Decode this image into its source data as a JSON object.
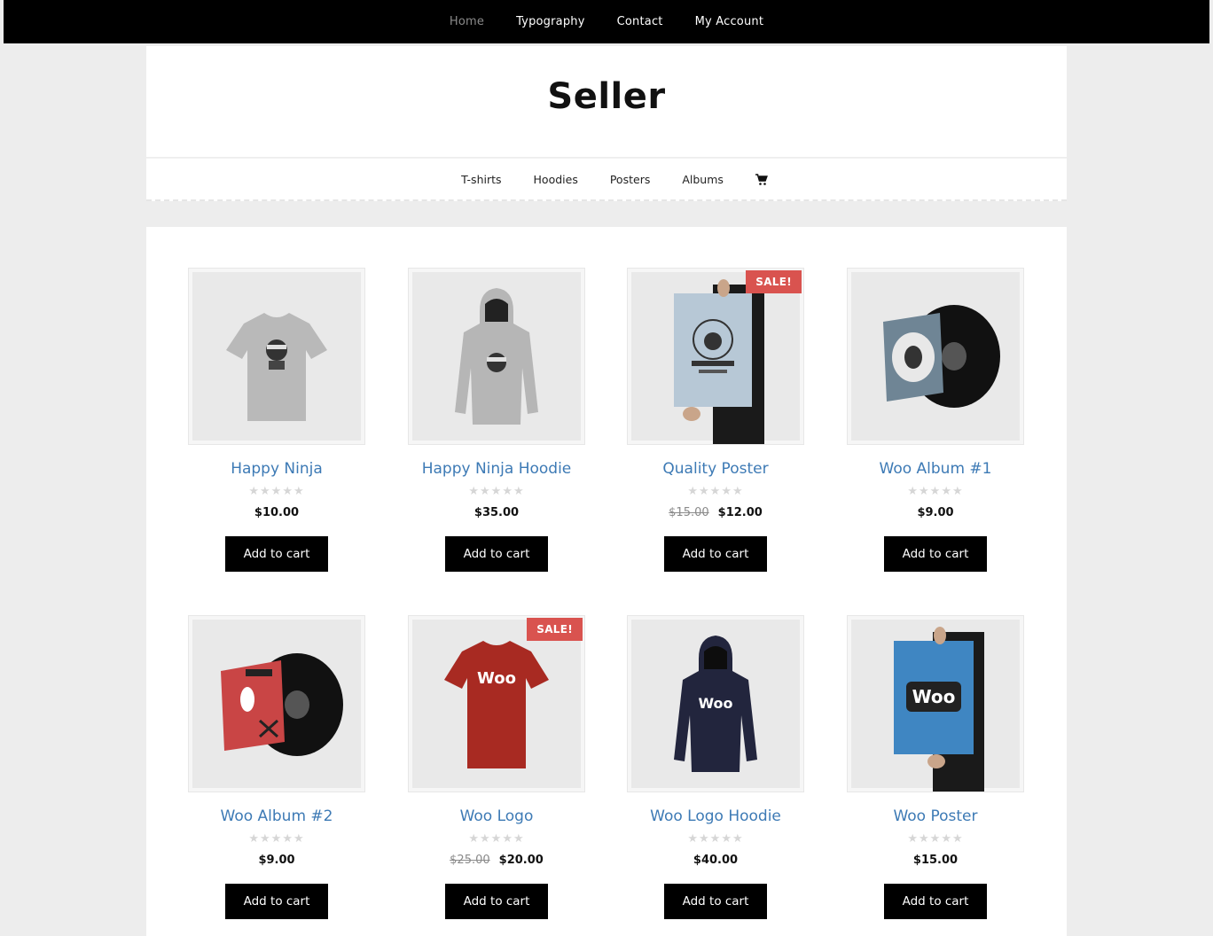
{
  "topnav": {
    "items": [
      {
        "label": "Home",
        "active": true
      },
      {
        "label": "Typography"
      },
      {
        "label": "Contact"
      },
      {
        "label": "My Account"
      }
    ]
  },
  "site": {
    "title": "Seller"
  },
  "categories": {
    "items": [
      "T-shirts",
      "Hoodies",
      "Posters",
      "Albums"
    ],
    "cart_icon": "cart-icon"
  },
  "products": [
    {
      "name": "Happy Ninja",
      "price": "$10.00",
      "old_price": "",
      "sale": "",
      "rating_stars": "★★★★★",
      "button": "Add to cart",
      "image": "grey-ninja-tshirt"
    },
    {
      "name": "Happy Ninja Hoodie",
      "price": "$35.00",
      "old_price": "",
      "sale": "",
      "rating_stars": "★★★★★",
      "button": "Add to cart",
      "image": "grey-ninja-hoodie"
    },
    {
      "name": "Quality Poster",
      "price": "$12.00",
      "old_price": "$15.00",
      "sale": "SALE!",
      "rating_stars": "★★★★★",
      "button": "Add to cart",
      "image": "blue-woothemes-poster"
    },
    {
      "name": "Woo Album #1",
      "price": "$9.00",
      "old_price": "",
      "sale": "",
      "rating_stars": "★★★★★",
      "button": "Add to cart",
      "image": "blue-album-vinyl"
    },
    {
      "name": "Woo Album #2",
      "price": "$9.00",
      "old_price": "",
      "sale": "",
      "rating_stars": "★★★★★",
      "button": "Add to cart",
      "image": "red-album-vinyl"
    },
    {
      "name": "Woo Logo",
      "price": "$20.00",
      "old_price": "$25.00",
      "sale": "SALE!",
      "rating_stars": "★★★★★",
      "button": "Add to cart",
      "image": "red-woo-tshirt"
    },
    {
      "name": "Woo Logo Hoodie",
      "price": "$40.00",
      "old_price": "",
      "sale": "",
      "rating_stars": "★★★★★",
      "button": "Add to cart",
      "image": "navy-woo-hoodie"
    },
    {
      "name": "Woo Poster",
      "price": "$15.00",
      "old_price": "",
      "sale": "",
      "rating_stars": "★★★★★",
      "button": "Add to cart",
      "image": "blue-woo-poster"
    }
  ],
  "colors": {
    "link": "#3d7ab5",
    "sale_badge": "#d9534f",
    "button_bg": "#000000",
    "topbar_bg": "#000000"
  }
}
